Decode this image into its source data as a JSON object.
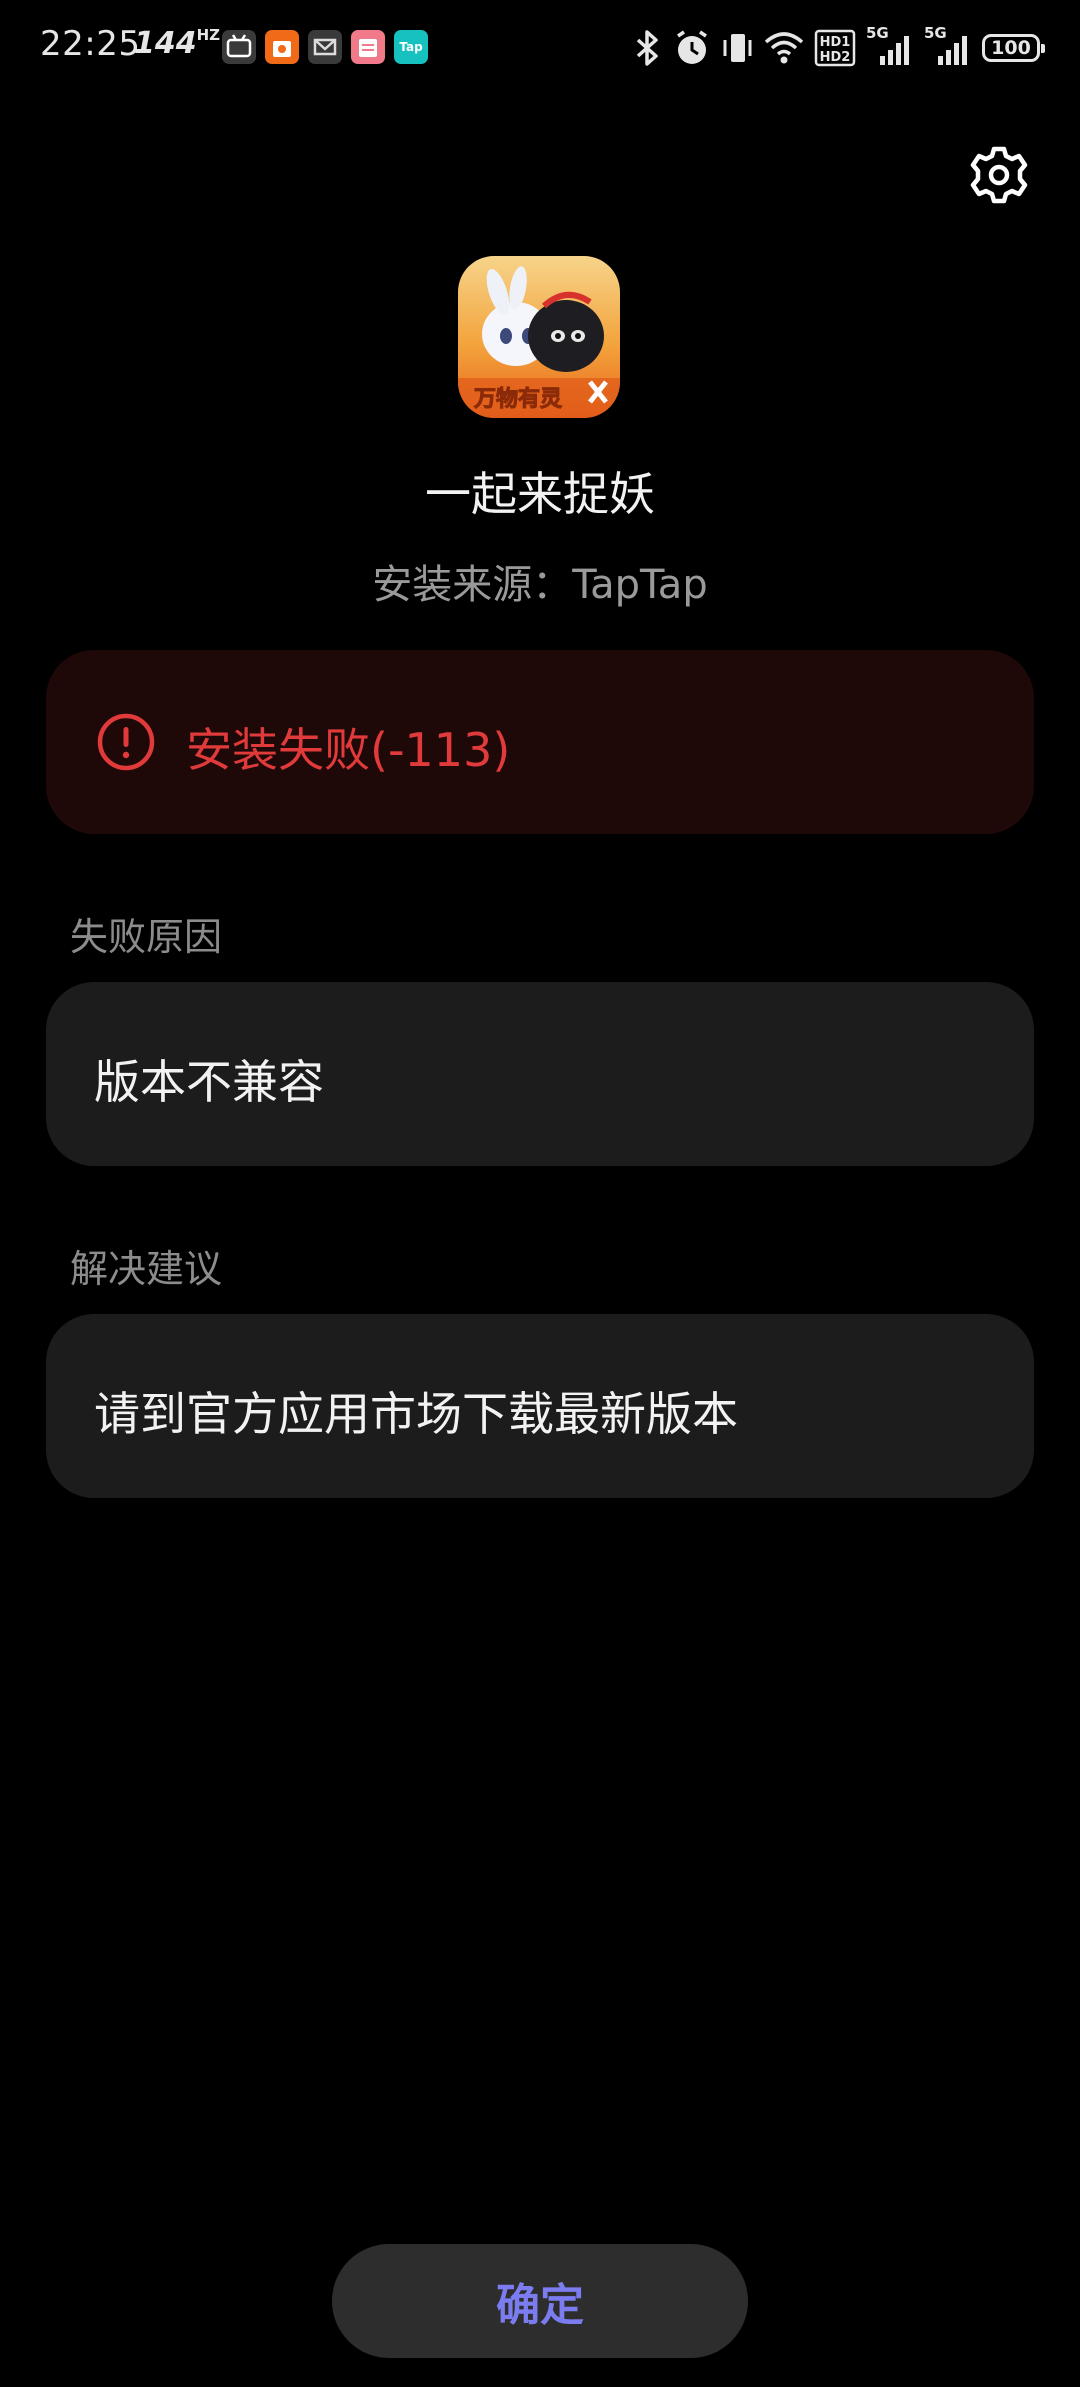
{
  "status_bar": {
    "time": "22:25",
    "refresh_rate": "144",
    "refresh_unit": "HZ",
    "app_icons": [
      "bilibili-icon",
      "bag-icon",
      "mail-icon",
      "calendar-icon",
      "taptap-icon"
    ],
    "taptap_label": "Tap",
    "network_left": "5G",
    "network_right": "5G",
    "battery": "100",
    "hd_top": "HD1",
    "hd_bottom": "HD2"
  },
  "header": {
    "settings_icon": "gear-icon"
  },
  "app": {
    "name": "一起来捉妖",
    "install_source": "安装来源：TapTap",
    "icon_text": "万物有灵"
  },
  "error": {
    "icon": "error-circle-icon",
    "message": "安装失败(-113)",
    "color": "#e03a3a"
  },
  "failure_reason": {
    "label": "失败原因",
    "value": "版本不兼容"
  },
  "suggestion": {
    "label": "解决建议",
    "value": "请到官方应用市场下载最新版本"
  },
  "actions": {
    "confirm_label": "确定",
    "accent": "#7b7cf0"
  }
}
